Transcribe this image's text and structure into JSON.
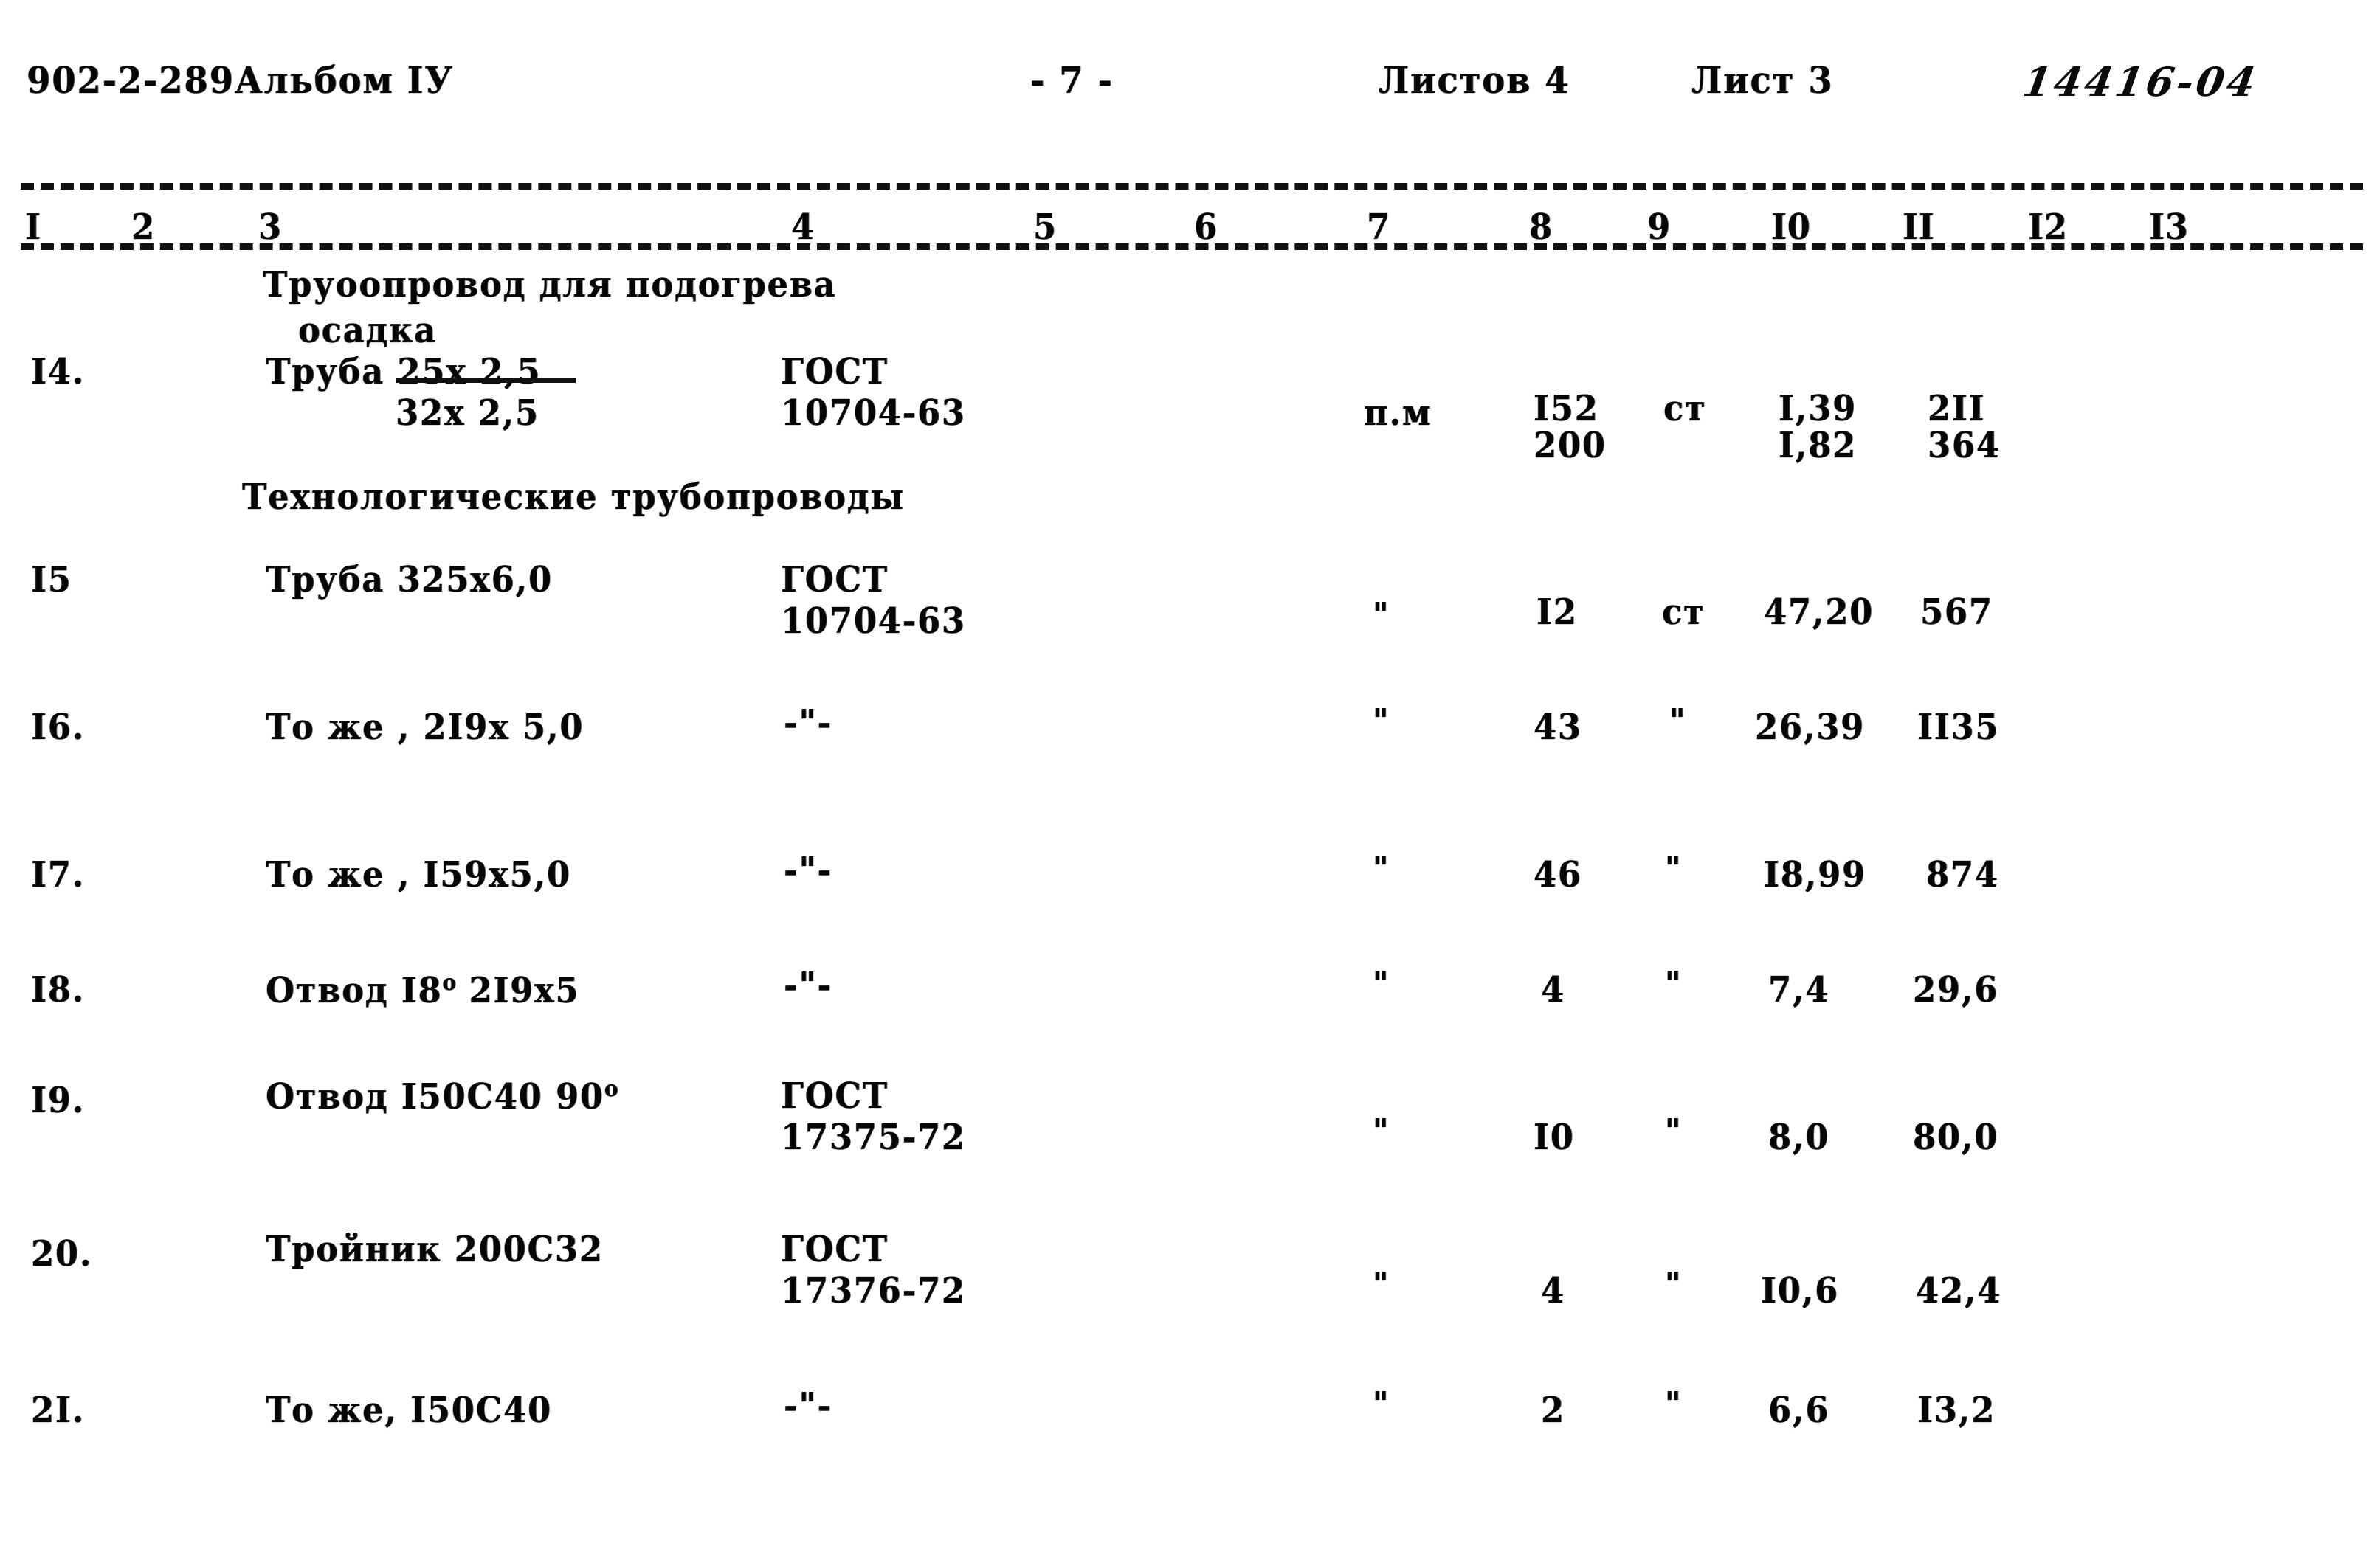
{
  "header": {
    "project_code": "902-2-289Альбом IУ",
    "page_number": "- 7 -",
    "sheets_total_label": "Листов 4",
    "sheet_label": "Лист 3",
    "doc_number": "14416-04"
  },
  "column_numbers": [
    "I",
    "2",
    "3",
    "4",
    "5",
    "6",
    "7",
    "8",
    "9",
    "I0",
    "II",
    "I2",
    "I3"
  ],
  "groups": [
    {
      "title_line1": "Труоопровод для подогрева",
      "title_line2": "осадка"
    },
    {
      "title_line1": "Технологические трубопроводы",
      "title_line2": ""
    }
  ],
  "rows": [
    {
      "no": "I4.",
      "name_line1": "Труба 25х 2,5",
      "name_line2": "32х 2,5",
      "standard_line1": "ГОСТ",
      "standard_line2": "10704-63",
      "unit": "п.м",
      "qty_line1": "I52",
      "qty_line2": "200",
      "material": "ст",
      "weight_unit_line1": "I,39",
      "weight_unit_line2": "I,82",
      "weight_total_line1": "2II",
      "weight_total_line2": "364"
    },
    {
      "no": "I5",
      "name_line1": "Труба 325х6,0",
      "name_line2": "",
      "standard_line1": "ГОСТ",
      "standard_line2": "10704-63",
      "unit": "\"",
      "qty_line1": "I2",
      "qty_line2": "",
      "material": "ст",
      "weight_unit_line1": "47,20",
      "weight_unit_line2": "",
      "weight_total_line1": "567",
      "weight_total_line2": ""
    },
    {
      "no": "I6.",
      "name_line1": "То же , 2I9х 5,0",
      "name_line2": "",
      "standard_line1": "-\"-",
      "standard_line2": "",
      "unit": "\"",
      "qty_line1": "43",
      "qty_line2": "",
      "material": "\"",
      "weight_unit_line1": "26,39",
      "weight_unit_line2": "",
      "weight_total_line1": "II35",
      "weight_total_line2": ""
    },
    {
      "no": "I7.",
      "name_line1": "То же , I59х5,0",
      "name_line2": "",
      "standard_line1": "-\"-",
      "standard_line2": "",
      "unit": "\"",
      "qty_line1": "46",
      "qty_line2": "",
      "material": "\"",
      "weight_unit_line1": "I8,99",
      "weight_unit_line2": "",
      "weight_total_line1": "874",
      "weight_total_line2": ""
    },
    {
      "no": "I8.",
      "name_line1": "Отвод I8",
      "name_sup": "о",
      "name_line1_tail": " 2I9х5",
      "name_line2": "",
      "standard_line1": "-\"-",
      "standard_line2": "",
      "unit": "\"",
      "qty_line1": "4",
      "qty_line2": "",
      "material": "\"",
      "weight_unit_line1": "7,4",
      "weight_unit_line2": "",
      "weight_total_line1": "29,6",
      "weight_total_line2": ""
    },
    {
      "no": "I9.",
      "name_line1": "Отвод I50С40 90",
      "name_sup": "о",
      "name_line1_tail": "",
      "name_line2": "",
      "standard_line1": "ГОСТ",
      "standard_line2": "17375-72",
      "unit": "\"",
      "qty_line1": "I0",
      "qty_line2": "",
      "material": "\"",
      "weight_unit_line1": "8,0",
      "weight_unit_line2": "",
      "weight_total_line1": "80,0",
      "weight_total_line2": ""
    },
    {
      "no": "20.",
      "name_line1": "Тройник 200С32",
      "name_line2": "",
      "standard_line1": "ГОСТ",
      "standard_line2": "17376-72",
      "unit": "\"",
      "qty_line1": "4",
      "qty_line2": "",
      "material": "\"",
      "weight_unit_line1": "I0,6",
      "weight_unit_line2": "",
      "weight_total_line1": "42,4",
      "weight_total_line2": ""
    },
    {
      "no": "2I.",
      "name_line1": "То же, I50С40",
      "name_line2": "",
      "standard_line1": "-\"-",
      "standard_line2": "",
      "unit": "\"",
      "qty_line1": "2",
      "qty_line2": "",
      "material": "\"",
      "weight_unit_line1": "6,6",
      "weight_unit_line2": "",
      "weight_total_line1": "I3,2",
      "weight_total_line2": ""
    }
  ]
}
